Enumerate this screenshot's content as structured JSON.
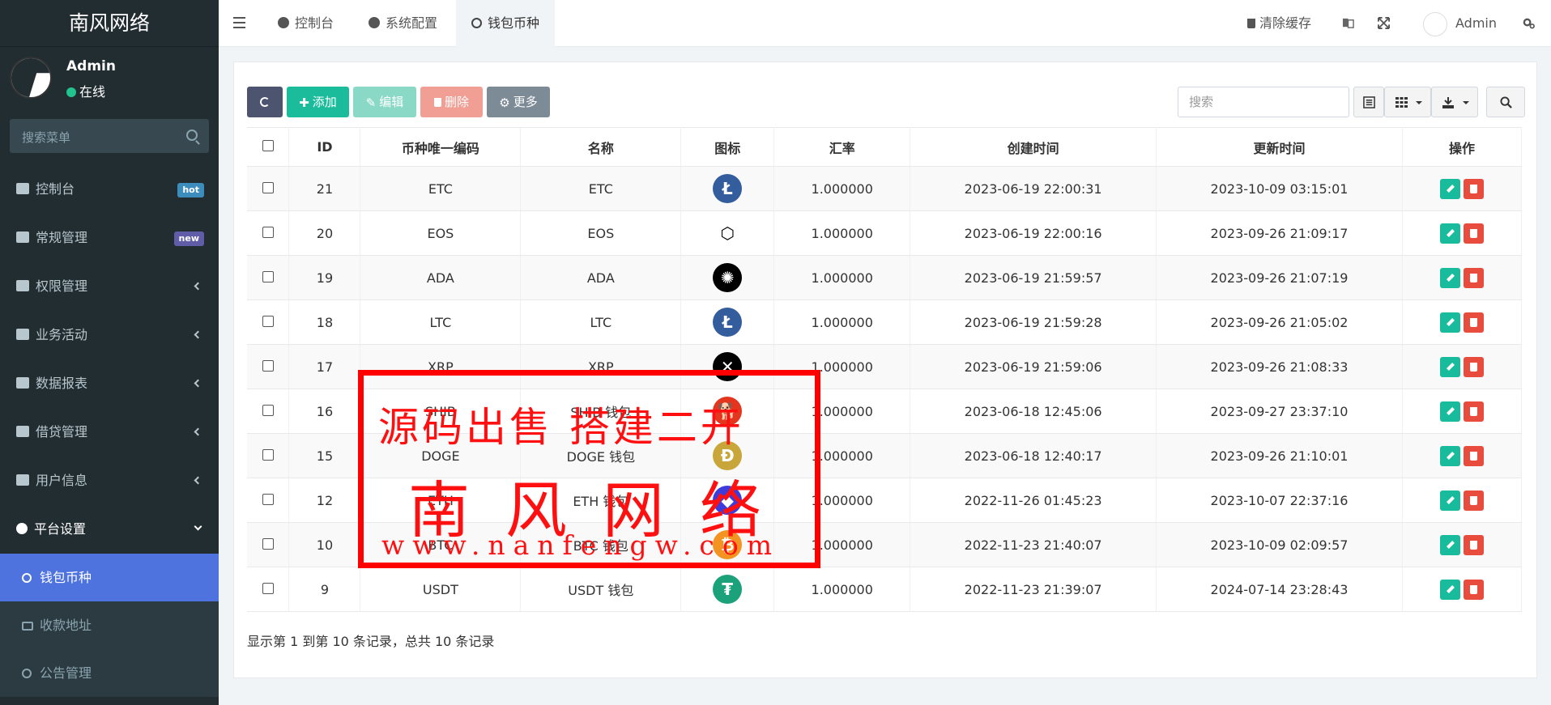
{
  "sidebar": {
    "brand": "南风网络",
    "user": {
      "name": "Admin",
      "status": "在线"
    },
    "search_placeholder": "搜索菜单",
    "menu": [
      {
        "label": "控制台",
        "badge": "hot"
      },
      {
        "label": "常规管理",
        "badge": "new"
      },
      {
        "label": "权限管理"
      },
      {
        "label": "业务活动"
      },
      {
        "label": "数据报表"
      },
      {
        "label": "借贷管理"
      },
      {
        "label": "用户信息"
      },
      {
        "label": "平台设置"
      }
    ],
    "submenu": [
      {
        "label": "钱包币种"
      },
      {
        "label": "收款地址"
      },
      {
        "label": "公告管理"
      }
    ]
  },
  "navbar": {
    "tabs": [
      {
        "label": "控制台"
      },
      {
        "label": "系统配置"
      },
      {
        "label": "钱包币种"
      }
    ],
    "clear_cache": "清除缓存",
    "admin": "Admin"
  },
  "toolbar": {
    "add": "添加",
    "edit": "编辑",
    "delete": "删除",
    "more": "更多",
    "search_placeholder": "搜索"
  },
  "table": {
    "columns": [
      "ID",
      "币种唯一编码",
      "名称",
      "图标",
      "汇率",
      "创建时间",
      "更新时间",
      "操作"
    ],
    "rows": [
      {
        "id": "21",
        "code": "ETC",
        "name": "ETC",
        "icon": "litecoin-icon",
        "rate": "1.000000",
        "created": "2023-06-19 22:00:31",
        "updated": "2023-10-09 03:15:01"
      },
      {
        "id": "20",
        "code": "EOS",
        "name": "EOS",
        "icon": "eos-icon",
        "rate": "1.000000",
        "created": "2023-06-19 22:00:16",
        "updated": "2023-09-26 21:09:17"
      },
      {
        "id": "19",
        "code": "ADA",
        "name": "ADA",
        "icon": "cardano-icon",
        "rate": "1.000000",
        "created": "2023-06-19 21:59:57",
        "updated": "2023-09-26 21:07:19"
      },
      {
        "id": "18",
        "code": "LTC",
        "name": "LTC",
        "icon": "litecoin-icon",
        "rate": "1.000000",
        "created": "2023-06-19 21:59:28",
        "updated": "2023-09-26 21:05:02"
      },
      {
        "id": "17",
        "code": "XRP",
        "name": "XRP",
        "icon": "xrp-icon",
        "rate": "1.000000",
        "created": "2023-06-19 21:59:06",
        "updated": "2023-09-26 21:08:33"
      },
      {
        "id": "16",
        "code": "SHIB",
        "name": "SHIB 钱包",
        "icon": "shiba-icon",
        "rate": "1.000000",
        "created": "2023-06-18 12:45:06",
        "updated": "2023-09-27 23:37:10"
      },
      {
        "id": "15",
        "code": "DOGE",
        "name": "DOGE 钱包",
        "icon": "dogecoin-icon",
        "rate": "1.000000",
        "created": "2023-06-18 12:40:17",
        "updated": "2023-09-26 21:10:01"
      },
      {
        "id": "12",
        "code": "ETH",
        "name": "ETH 钱包",
        "icon": "ethereum-icon",
        "rate": "1.000000",
        "created": "2022-11-26 01:45:23",
        "updated": "2023-10-07 22:37:16"
      },
      {
        "id": "10",
        "code": "BTC",
        "name": "BTC 钱包",
        "icon": "bitcoin-icon",
        "rate": "1.000000",
        "created": "2022-11-23 21:40:07",
        "updated": "2023-10-09 02:09:57"
      },
      {
        "id": "9",
        "code": "USDT",
        "name": "USDT 钱包",
        "icon": "tether-icon",
        "rate": "1.000000",
        "created": "2022-11-23 21:39:07",
        "updated": "2024-07-14 23:28:43"
      }
    ]
  },
  "pagination_info": "显示第 1 到第 10 条记录，总共 10 条记录",
  "watermark": {
    "line1": "源码出售 搭建二开",
    "line2": "南风网络",
    "line3": "www.nanfengw.com"
  },
  "colors": {
    "sidebar_bg": "#222d32",
    "active_menu": "#4e73df",
    "success": "#18bc9c",
    "danger": "#e74c3c",
    "watermark": "#ff0000"
  }
}
